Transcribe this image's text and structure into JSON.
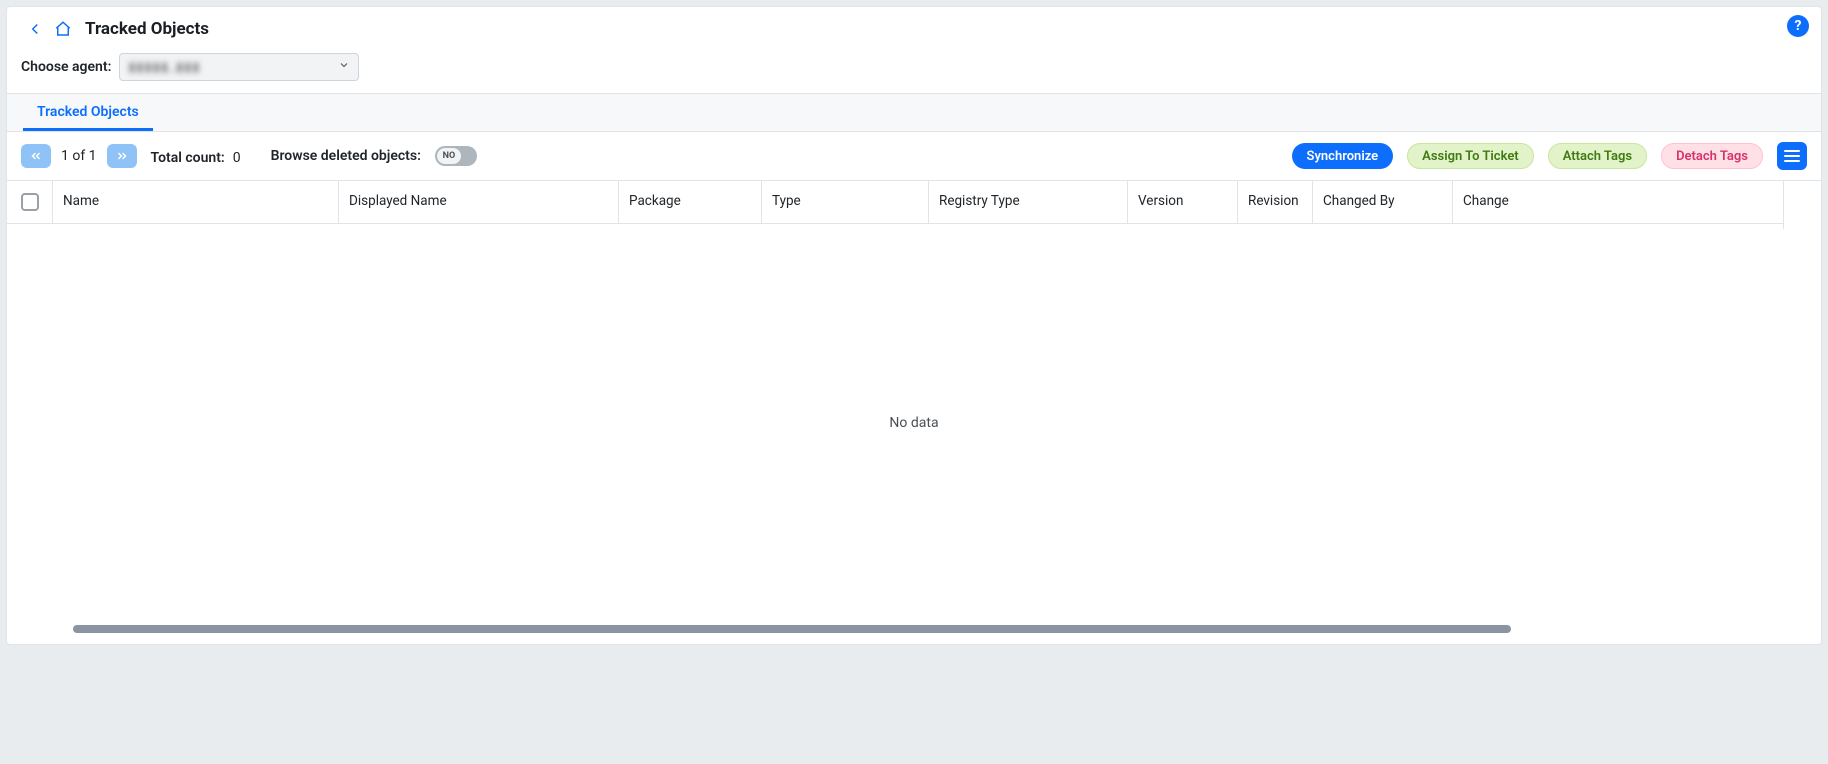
{
  "header": {
    "title": "Tracked Objects",
    "agent_label": "Choose agent:",
    "agent_value_masked": "▮▮▮▮▮_▮▮▮"
  },
  "tabs": [
    {
      "label": "Tracked Objects",
      "active": true
    }
  ],
  "toolbar": {
    "pager_text": "1 of 1",
    "total_count_label": "Total count:",
    "total_count_value": "0",
    "browse_deleted_label": "Browse deleted objects:",
    "toggle_text": "NO",
    "buttons": {
      "synchronize": "Synchronize",
      "assign": "Assign To Ticket",
      "attach": "Attach Tags",
      "detach": "Detach Tags"
    }
  },
  "table": {
    "columns": {
      "name": "Name",
      "displayed_name": "Displayed Name",
      "package": "Package",
      "type": "Type",
      "registry_type": "Registry Type",
      "version": "Version",
      "revision": "Revision",
      "changed_by": "Changed By",
      "changed": "Change"
    },
    "empty_text": "No data"
  }
}
